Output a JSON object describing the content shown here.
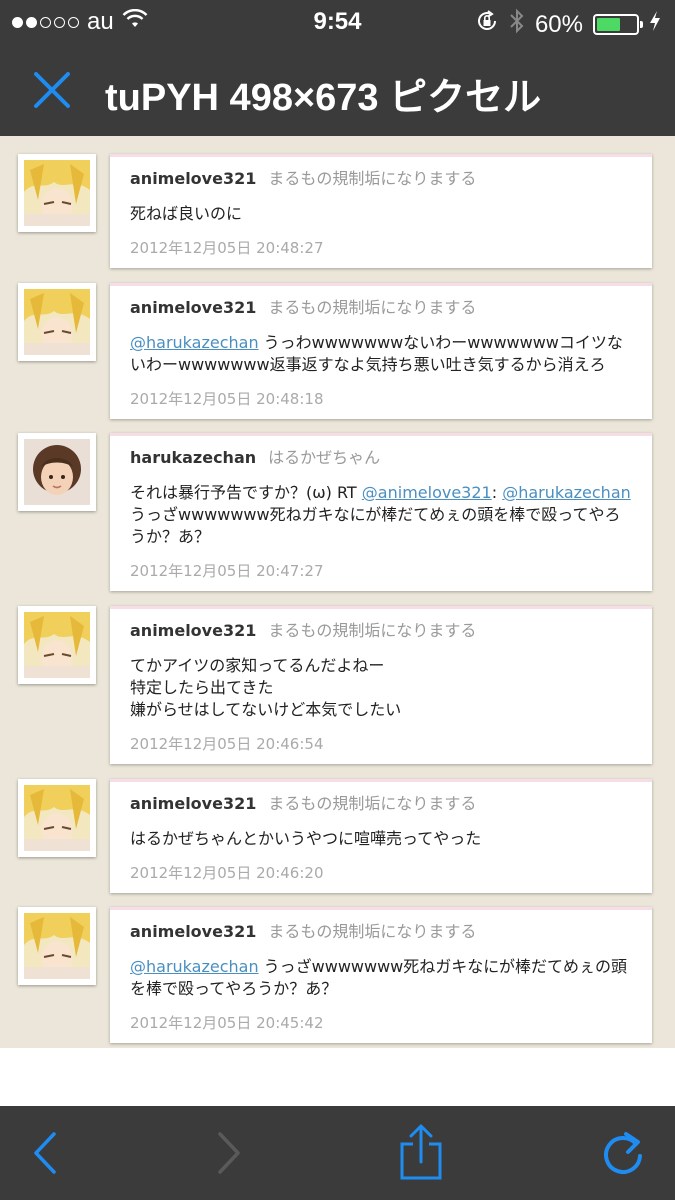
{
  "status_bar": {
    "carrier": "au",
    "time": "9:54",
    "battery": "60%",
    "battery_level": 0.6,
    "signal_bars_filled": 2,
    "signal_bars_total": 5
  },
  "title_bar": {
    "title": "tuPYH 498×673 ピクセル"
  },
  "tweets": [
    {
      "username": "animelove321",
      "display_name": "まるもの規制垢になりまする",
      "mention": "",
      "text": "死ねば良いのに",
      "time": "2012年12月05日 20:48:27"
    },
    {
      "username": "animelove321",
      "display_name": "まるもの規制垢になりまする",
      "mention": "@harukazechan",
      "text": " うっわwwwwwwwないわーwwwwwwwコイツないわーwwwwwww返事返すなよ気持ち悪い吐き気するから消えろ",
      "time": "2012年12月05日 20:48:18"
    },
    {
      "username": "harukazechan",
      "display_name": "はるかぜちゃん",
      "text_prefix": "それは暴行予告ですか？(ω) RT ",
      "mention1": "@animelove321",
      "colon": ": ",
      "mention2": "@harukazechan",
      "text_suffix": " うっざwwwwwww死ねガキなにが棒だてめぇの頭を棒で殴ってやろうか？あ？",
      "time": "2012年12月05日 20:47:27"
    },
    {
      "username": "animelove321",
      "display_name": "まるもの規制垢になりまする",
      "line1": "てかアイツの家知ってるんだよねー",
      "line2": "特定したら出てきた",
      "line3": "嫌がらせはしてないけど本気でしたい",
      "time": "2012年12月05日 20:46:54"
    },
    {
      "username": "animelove321",
      "display_name": "まるもの規制垢になりまする",
      "text": "はるかぜちゃんとかいうやつに喧嘩売ってやった",
      "time": "2012年12月05日 20:46:20"
    },
    {
      "username": "animelove321",
      "display_name": "まるもの規制垢になりまする",
      "mention": "@harukazechan",
      "text": " うっざwwwwwww死ねガキなにが棒だてめぇの頭を棒で殴ってやろうか？あ？",
      "time": "2012年12月05日 20:45:42"
    }
  ],
  "toolbar": {
    "back_icon": "chevron-left-icon",
    "forward_icon": "chevron-right-icon",
    "share_icon": "share-icon",
    "reload_icon": "reload-icon"
  },
  "colors": {
    "bar_bg": "#3b3b3b",
    "accent": "#1e8cf0",
    "content_bg": "#ebe6d9",
    "mention": "#4a8fc1",
    "battery_green": "#4cd964"
  }
}
